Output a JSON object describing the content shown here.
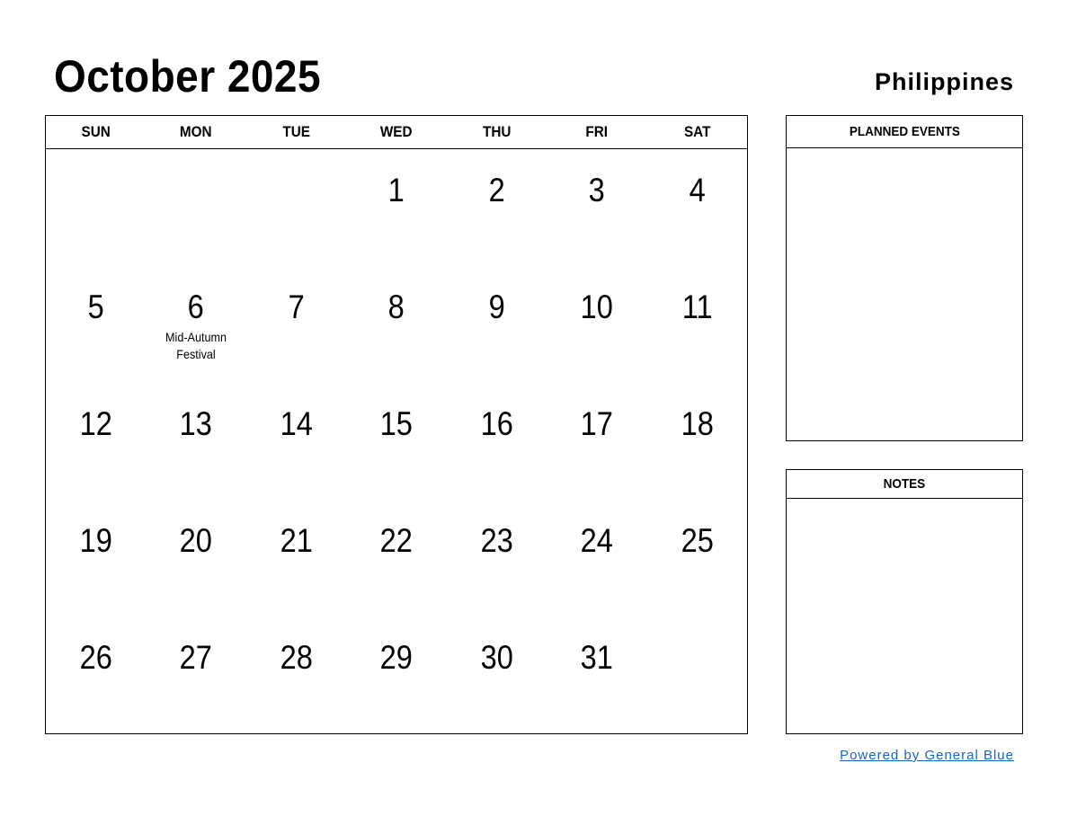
{
  "header": {
    "title": "October 2025",
    "country": "Philippines"
  },
  "calendar": {
    "weekdays": [
      "SUN",
      "MON",
      "TUE",
      "WED",
      "THU",
      "FRI",
      "SAT"
    ],
    "cells": [
      {
        "day": "",
        "event": ""
      },
      {
        "day": "",
        "event": ""
      },
      {
        "day": "",
        "event": ""
      },
      {
        "day": "1",
        "event": ""
      },
      {
        "day": "2",
        "event": ""
      },
      {
        "day": "3",
        "event": ""
      },
      {
        "day": "4",
        "event": ""
      },
      {
        "day": "5",
        "event": ""
      },
      {
        "day": "6",
        "event": "Mid-Autumn Festival"
      },
      {
        "day": "7",
        "event": ""
      },
      {
        "day": "8",
        "event": ""
      },
      {
        "day": "9",
        "event": ""
      },
      {
        "day": "10",
        "event": ""
      },
      {
        "day": "11",
        "event": ""
      },
      {
        "day": "12",
        "event": ""
      },
      {
        "day": "13",
        "event": ""
      },
      {
        "day": "14",
        "event": ""
      },
      {
        "day": "15",
        "event": ""
      },
      {
        "day": "16",
        "event": ""
      },
      {
        "day": "17",
        "event": ""
      },
      {
        "day": "18",
        "event": ""
      },
      {
        "day": "19",
        "event": ""
      },
      {
        "day": "20",
        "event": ""
      },
      {
        "day": "21",
        "event": ""
      },
      {
        "day": "22",
        "event": ""
      },
      {
        "day": "23",
        "event": ""
      },
      {
        "day": "24",
        "event": ""
      },
      {
        "day": "25",
        "event": ""
      },
      {
        "day": "26",
        "event": ""
      },
      {
        "day": "27",
        "event": ""
      },
      {
        "day": "28",
        "event": ""
      },
      {
        "day": "29",
        "event": ""
      },
      {
        "day": "30",
        "event": ""
      },
      {
        "day": "31",
        "event": ""
      },
      {
        "day": "",
        "event": ""
      }
    ]
  },
  "sidebar": {
    "planned_events_label": "PLANNED EVENTS",
    "notes_label": "NOTES"
  },
  "footer": {
    "powered_by": "Powered by General Blue",
    "link_color": "#1a66b8"
  }
}
